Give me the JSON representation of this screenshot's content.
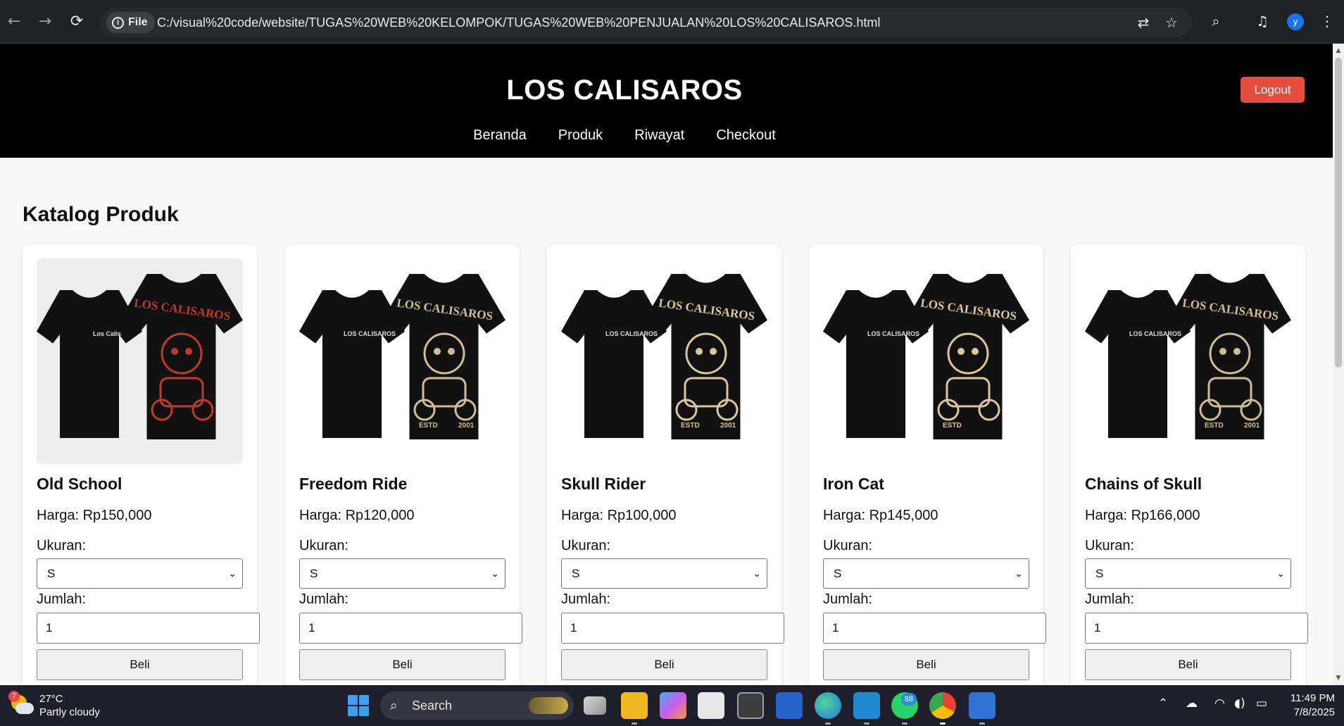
{
  "browser": {
    "site_info_label": "File",
    "url": "C:/visual%20code/website/TUGAS%20WEB%20KELOMPOK/TUGAS%20WEB%20PENJUALAN%20LOS%20CALISAROS.html",
    "profile_initial": "y"
  },
  "site": {
    "brand": "LOS CALISAROS",
    "logout_label": "Logout",
    "nav": [
      {
        "label": "Beranda"
      },
      {
        "label": "Produk"
      },
      {
        "label": "Riwayat"
      },
      {
        "label": "Checkout"
      }
    ],
    "accent_color": "#e74c3c"
  },
  "catalog": {
    "title": "Katalog Produk",
    "size_label": "Ukuran:",
    "qty_label": "Jumlah:",
    "buy_label": "Beli",
    "products": [
      {
        "name": "Old School",
        "price": "Harga: Rp150,000",
        "size": "S",
        "qty": "1",
        "graphic": "skull-biker",
        "graphic_color": "#c0392b",
        "front_text": "Los Calis",
        "back_text": "LOS CALISAROS",
        "estd": "",
        "year": ""
      },
      {
        "name": "Freedom Ride",
        "price": "Harga: Rp120,000",
        "size": "S",
        "qty": "1",
        "graphic": "samurai-skull",
        "graphic_color": "#cdbf94",
        "front_text": "LOS CALISAROS",
        "back_text": "LOS CALISAROS",
        "estd": "ESTD",
        "year": "2001"
      },
      {
        "name": "Skull Rider",
        "price": "Harga: Rp100,000",
        "size": "S",
        "qty": "1",
        "graphic": "flaming-motorcycle",
        "graphic_color": "#d8c89b",
        "front_text": "LOS CALISAROS",
        "back_text": "LOS CALISAROS",
        "estd": "ESTD",
        "year": "2001"
      },
      {
        "name": "Iron Cat",
        "price": "Harga: Rp145,000",
        "size": "S",
        "qty": "1",
        "graphic": "skeleton-rider",
        "graphic_color": "#d8c89b",
        "front_text": "LOS CALISAROS",
        "back_text": "LOS CALISAROS",
        "estd": "ESTD",
        "year": ""
      },
      {
        "name": "Chains of Skull",
        "price": "Harga: Rp166,000",
        "size": "S",
        "qty": "1",
        "graphic": "roaring-bear",
        "graphic_color": "#cdbf94",
        "front_text": "LOS CALISAROS",
        "back_text": "LOS CALISAROS",
        "estd": "ESTD",
        "year": "2001"
      }
    ]
  },
  "taskbar": {
    "weather_badge": "7",
    "temperature": "27°C",
    "condition": "Partly cloudy",
    "search_placeholder": "Search",
    "whatsapp_badge": "88",
    "time": "11:49 PM",
    "date": "7/8/2025"
  }
}
